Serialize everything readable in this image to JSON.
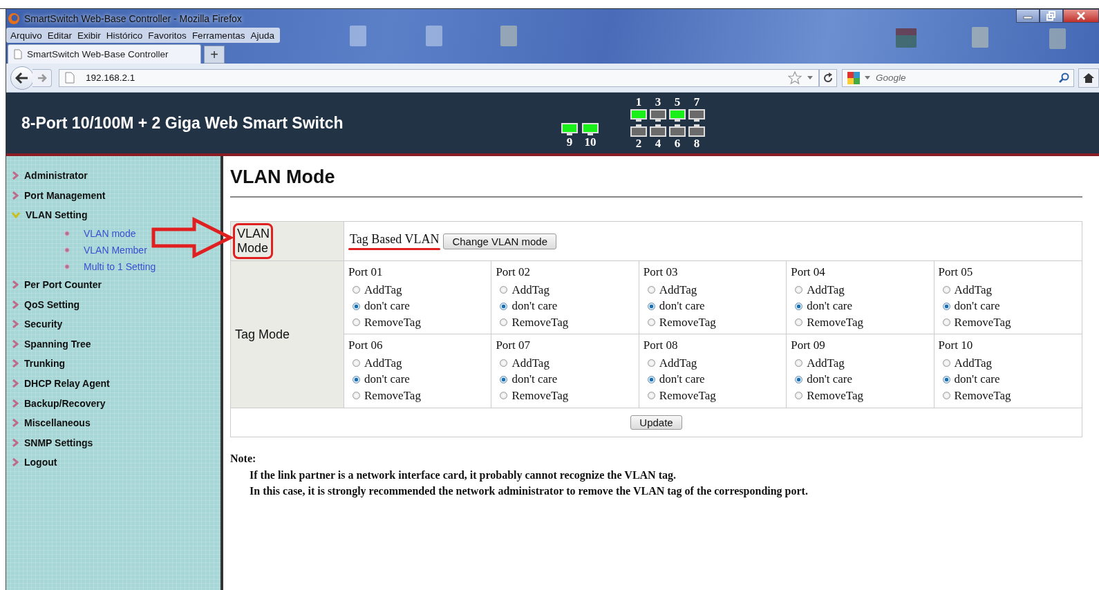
{
  "window": {
    "title": "SmartSwitch Web-Base Controller - Mozilla Firefox"
  },
  "menu": [
    "Arquivo",
    "Editar",
    "Exibir",
    "Histórico",
    "Favoritos",
    "Ferramentas",
    "Ajuda"
  ],
  "tabs": [
    {
      "label": "SmartSwitch Web-Base Controller",
      "selected": true
    }
  ],
  "new_tab": "+",
  "address": {
    "url": "192.168.2.1"
  },
  "search": {
    "placeholder": "Google"
  },
  "header": {
    "title": "8-Port 10/100M + 2 Giga Web Smart Switch",
    "ports": [
      {
        "label": "1",
        "link": true
      },
      {
        "label": "3",
        "link": false
      },
      {
        "label": "5",
        "link": true
      },
      {
        "label": "7",
        "link": false
      },
      {
        "label": "9",
        "link": true
      },
      {
        "label": "10",
        "link": true
      },
      {
        "label": "2",
        "link": false
      },
      {
        "label": "4",
        "link": false
      },
      {
        "label": "6",
        "link": false
      },
      {
        "label": "8",
        "link": false
      }
    ]
  },
  "sidebar": {
    "items": [
      {
        "label": "Administrator",
        "expanded": false
      },
      {
        "label": "Port Management",
        "expanded": false
      },
      {
        "label": "VLAN Setting",
        "expanded": true,
        "children": [
          {
            "label": "VLAN mode"
          },
          {
            "label": "VLAN Member"
          },
          {
            "label": "Multi to 1 Setting"
          }
        ]
      },
      {
        "label": "Per Port Counter",
        "expanded": false
      },
      {
        "label": "QoS Setting",
        "expanded": false
      },
      {
        "label": "Security",
        "expanded": false
      },
      {
        "label": "Spanning Tree",
        "expanded": false
      },
      {
        "label": "Trunking",
        "expanded": false
      },
      {
        "label": "DHCP Relay Agent",
        "expanded": false
      },
      {
        "label": "Backup/Recovery",
        "expanded": false
      },
      {
        "label": "Miscellaneous",
        "expanded": false
      },
      {
        "label": "SNMP Settings",
        "expanded": false
      },
      {
        "label": "Logout",
        "expanded": false
      }
    ]
  },
  "page": {
    "heading": "VLAN Mode",
    "vlan_mode": {
      "label": "VLAN Mode",
      "value": "Tag Based VLAN",
      "button": "Change VLAN mode"
    },
    "tag_mode": {
      "label": "Tag Mode",
      "ports": [
        {
          "name": "Port 01",
          "options": [
            {
              "label": "AddTag",
              "selected": false
            },
            {
              "label": "don't care",
              "selected": true
            },
            {
              "label": "RemoveTag",
              "selected": false
            }
          ]
        },
        {
          "name": "Port 02",
          "options": [
            {
              "label": "AddTag",
              "selected": false
            },
            {
              "label": "don't care",
              "selected": true
            },
            {
              "label": "RemoveTag",
              "selected": false
            }
          ]
        },
        {
          "name": "Port 03",
          "options": [
            {
              "label": "AddTag",
              "selected": false
            },
            {
              "label": "don't care",
              "selected": true
            },
            {
              "label": "RemoveTag",
              "selected": false
            }
          ]
        },
        {
          "name": "Port 04",
          "options": [
            {
              "label": "AddTag",
              "selected": false
            },
            {
              "label": "don't care",
              "selected": true
            },
            {
              "label": "RemoveTag",
              "selected": false
            }
          ]
        },
        {
          "name": "Port 05",
          "options": [
            {
              "label": "AddTag",
              "selected": false
            },
            {
              "label": "don't care",
              "selected": true
            },
            {
              "label": "RemoveTag",
              "selected": false
            }
          ]
        },
        {
          "name": "Port 06",
          "options": [
            {
              "label": "AddTag",
              "selected": false
            },
            {
              "label": "don't care",
              "selected": true
            },
            {
              "label": "RemoveTag",
              "selected": false
            }
          ]
        },
        {
          "name": "Port 07",
          "options": [
            {
              "label": "AddTag",
              "selected": false
            },
            {
              "label": "don't care",
              "selected": true
            },
            {
              "label": "RemoveTag",
              "selected": false
            }
          ]
        },
        {
          "name": "Port 08",
          "options": [
            {
              "label": "AddTag",
              "selected": false
            },
            {
              "label": "don't care",
              "selected": true
            },
            {
              "label": "RemoveTag",
              "selected": false
            }
          ]
        },
        {
          "name": "Port 09",
          "options": [
            {
              "label": "AddTag",
              "selected": false
            },
            {
              "label": "don't care",
              "selected": true
            },
            {
              "label": "RemoveTag",
              "selected": false
            }
          ]
        },
        {
          "name": "Port 10",
          "options": [
            {
              "label": "AddTag",
              "selected": false
            },
            {
              "label": "don't care",
              "selected": true
            },
            {
              "label": "RemoveTag",
              "selected": false
            }
          ]
        }
      ]
    },
    "update_button": "Update",
    "note": {
      "title": "Note:",
      "lines": [
        "If the link partner is a network interface card, it probably cannot recognize the VLAN tag.",
        "In this case, it is strongly recommended the network administrator to remove the VLAN tag of the corresponding port."
      ]
    }
  }
}
